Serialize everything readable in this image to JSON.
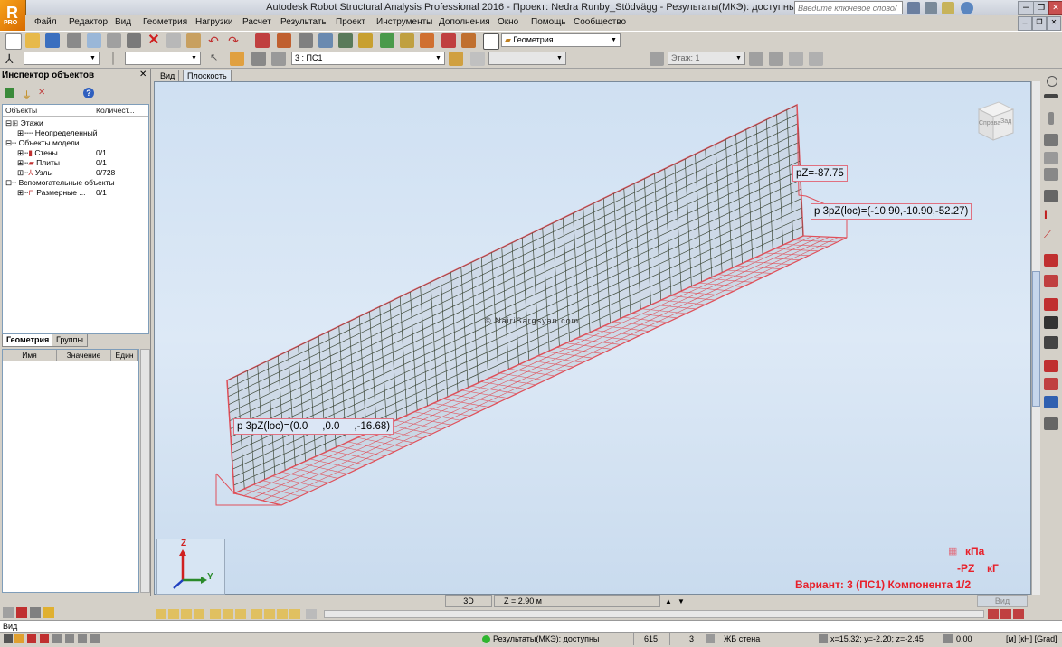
{
  "window": {
    "title": "Autodesk Robot Structural Analysis Professional 2016 - Проект: Nedra Runby_Stödvägg - Результаты(МКЭ): доступны",
    "logo_letter": "R",
    "logo_sub": "PRO",
    "help_search_placeholder": "Введите ключевое слово/фразу"
  },
  "menu": [
    "Файл",
    "Редактор",
    "Вид",
    "Геометрия",
    "Нагрузки",
    "Расчет",
    "Результаты",
    "Проект",
    "Инструменты",
    "Дополнения",
    "Окно",
    "Помощь",
    "Сообщество"
  ],
  "toolbar": {
    "layout_combo": "Геометрия",
    "load_case_combo": "3 : ПС1",
    "story_combo": "Этаж: 1"
  },
  "inspector": {
    "title": "Инспектор объектов",
    "col_objects": "Объекты",
    "col_count": "Количест...",
    "tree": [
      {
        "label": "Этажи",
        "count": "",
        "indent": 0
      },
      {
        "label": "Неопределенный",
        "count": "",
        "indent": 1
      },
      {
        "label": "Объекты модели",
        "count": "",
        "indent": 0
      },
      {
        "label": "Стены",
        "count": "0/1",
        "indent": 1
      },
      {
        "label": "Плиты",
        "count": "0/1",
        "indent": 1
      },
      {
        "label": "Узлы",
        "count": "0/728",
        "indent": 1
      },
      {
        "label": "Вспомогательные объекты",
        "count": "",
        "indent": 0
      },
      {
        "label": "Размерные ...",
        "count": "0/1",
        "indent": 1
      }
    ],
    "tab_geometry": "Геометрия",
    "tab_groups": "Группы",
    "prop_name": "Имя",
    "prop_value": "Значение",
    "prop_unit": "Един"
  },
  "view_tabs": [
    "Вид",
    "Плоскость"
  ],
  "viewport": {
    "cube_label_front": "Справа",
    "cube_label_side": "Зад",
    "label_pz": "pZ=-87.75",
    "label_3pz_right": "p 3pZ(loc)=(-10.90,-10.90,-52.27)",
    "label_3pz_left": "p 3pZ(loc)=(0.0     ,0.0     ,-16.68)",
    "watermark": "© NairiSargsyan.com",
    "axis_z": "Z",
    "axis_y": "Y",
    "legend_unit_top": "кПа",
    "legend_component": "-PZ",
    "legend_unit_bottom": "кГ",
    "variant": "Вариант: 3 (ПС1) Компонента 1/2",
    "corner_label": "Вид"
  },
  "view_status": {
    "mode": "3D",
    "z_level": "Z = 2.90 м"
  },
  "cmdline": "Вид",
  "status": {
    "results": "Результаты(МКЭ): доступны",
    "num1": "615",
    "num2": "3",
    "section": "ЖБ стена",
    "coords": "x=15.32; y=-2.20; z=-2.45",
    "value": "0.00",
    "units": "[м] [кН] [Grad]"
  },
  "colors": {
    "accent_red": "#e8202a",
    "mesh_red": "#e0505a",
    "mesh_grid": "#3f4a3a",
    "wall_fill": "#c6d0dc"
  }
}
